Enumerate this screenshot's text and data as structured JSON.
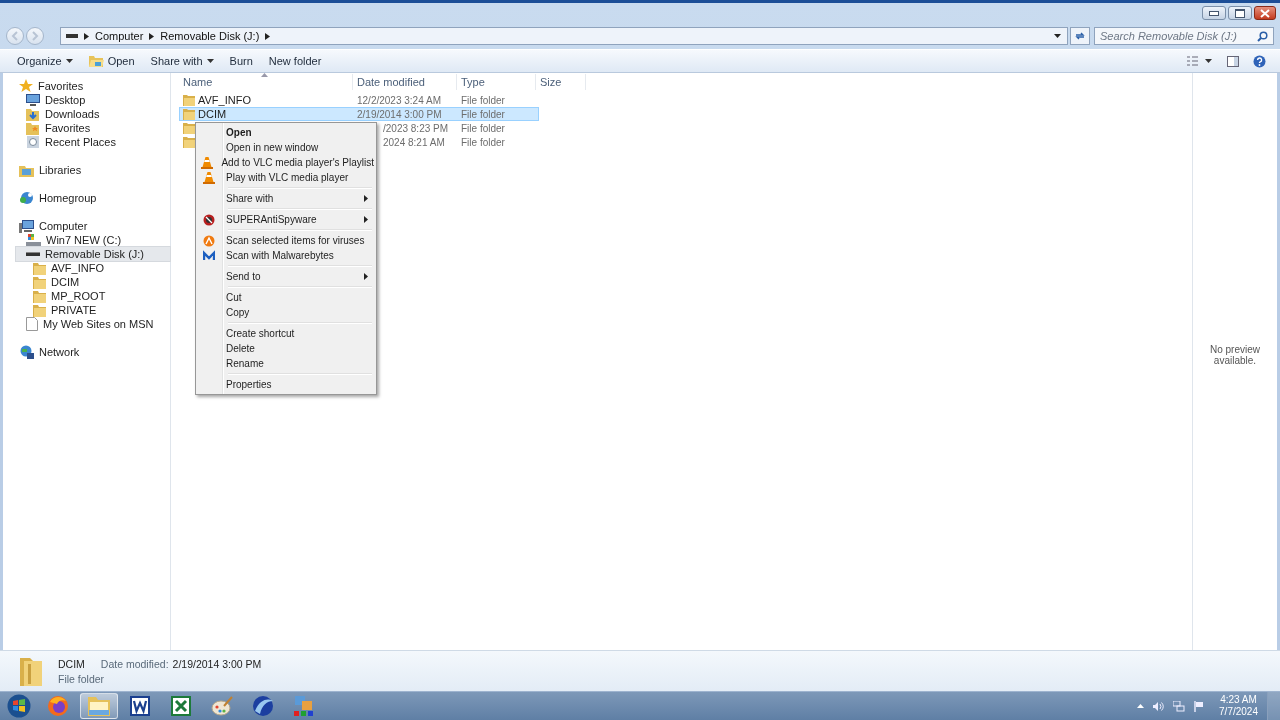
{
  "address": {
    "crumbs": [
      "Computer",
      "Removable Disk (J:)"
    ]
  },
  "search": {
    "placeholder": "Search Removable Disk (J:)"
  },
  "toolbar": {
    "buttons": [
      {
        "label": "Organize",
        "dropdown": true
      },
      {
        "label": "Open",
        "dropdown": false
      },
      {
        "label": "Share with",
        "dropdown": true
      },
      {
        "label": "Burn",
        "dropdown": false
      },
      {
        "label": "New folder",
        "dropdown": false
      }
    ]
  },
  "nav": [
    {
      "label": "Favorites",
      "selected": false,
      "children": [
        {
          "label": "Desktop",
          "selected": false
        },
        {
          "label": "Downloads",
          "selected": false
        },
        {
          "label": "Favorites",
          "selected": false
        },
        {
          "label": "Recent Places",
          "selected": false
        }
      ]
    },
    {
      "label": "Libraries",
      "selected": false
    },
    {
      "label": "Homegroup",
      "selected": false
    },
    {
      "label": "Computer",
      "selected": false,
      "children": [
        {
          "label": "Win7 NEW (C:)",
          "selected": false
        },
        {
          "label": "Removable Disk (J:)",
          "selected": true,
          "children": [
            {
              "label": "AVF_INFO",
              "selected": false
            },
            {
              "label": "DCIM",
              "selected": false
            },
            {
              "label": "MP_ROOT",
              "selected": false
            },
            {
              "label": "PRIVATE",
              "selected": false
            }
          ]
        },
        {
          "label": "My Web Sites on MSN",
          "selected": false
        }
      ]
    },
    {
      "label": "Network",
      "selected": false
    }
  ],
  "columns": [
    "Name",
    "Date modified",
    "Type",
    "Size"
  ],
  "files": [
    {
      "name": "AVF_INFO",
      "date": "12/2/2023 3:24 AM",
      "type": "File folder",
      "selected": false
    },
    {
      "name": "DCIM",
      "date": "2/19/2014 3:00 PM",
      "type": "File folder",
      "selected": true
    },
    {
      "date": "/2023 8:23 PM",
      "type": "File folder",
      "selected": false
    },
    {
      "date": "2024 8:21 AM",
      "type": "File folder",
      "selected": false
    }
  ],
  "menu": {
    "groups": [
      [
        {
          "label": "Open",
          "default": true,
          "submenu": false
        },
        {
          "label": "Open in new window",
          "default": false,
          "submenu": false
        },
        {
          "label": "Add to VLC media player's Playlist",
          "default": false,
          "submenu": false
        },
        {
          "label": "Play with VLC media player",
          "default": false,
          "submenu": false
        }
      ],
      [
        {
          "label": "Share with",
          "default": false,
          "submenu": true
        }
      ],
      [
        {
          "label": "SUPERAntiSpyware",
          "default": false,
          "submenu": true
        }
      ],
      [
        {
          "label": "Scan selected items for viruses",
          "default": false,
          "submenu": false
        },
        {
          "label": "Scan with Malwarebytes",
          "default": false,
          "submenu": false
        }
      ],
      [
        {
          "label": "Send to",
          "default": false,
          "submenu": true
        }
      ],
      [
        {
          "label": "Cut",
          "default": false,
          "submenu": false
        },
        {
          "label": "Copy",
          "default": false,
          "submenu": false
        }
      ],
      [
        {
          "label": "Create shortcut",
          "default": false,
          "submenu": false
        },
        {
          "label": "Delete",
          "default": false,
          "submenu": false
        },
        {
          "label": "Rename",
          "default": false,
          "submenu": false
        }
      ],
      [
        {
          "label": "Properties",
          "default": false,
          "submenu": false
        }
      ]
    ]
  },
  "preview": {
    "message": "No preview available."
  },
  "details": {
    "name": "DCIM",
    "date_label": "Date modified:",
    "date": "2/19/2014 3:00 PM",
    "type": "File folder"
  },
  "clock": {
    "time": "4:23 AM",
    "date": "7/7/2024"
  }
}
